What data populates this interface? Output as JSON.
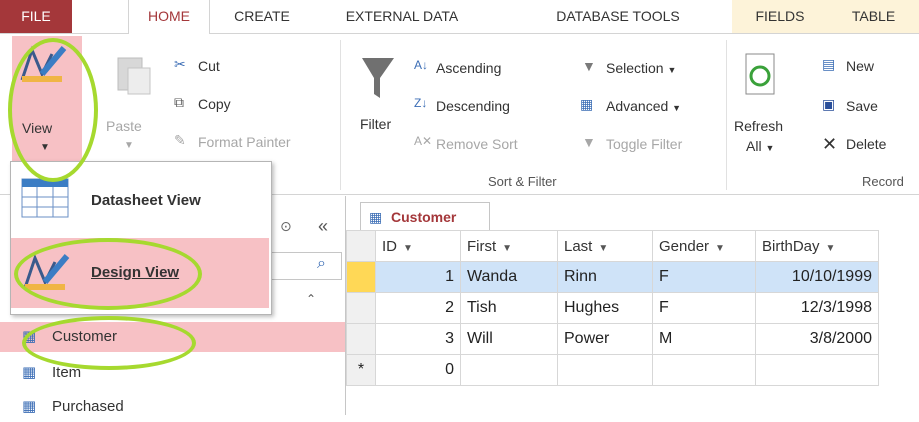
{
  "tabs": [
    "FILE",
    "HOME",
    "CREATE",
    "EXTERNAL DATA",
    "DATABASE TOOLS",
    "FIELDS",
    "TABLE"
  ],
  "ribbon": {
    "view_label": "View",
    "paste_label": "Paste",
    "cut_label": "Cut",
    "copy_label": "Copy",
    "format_painter_label": "Format Painter",
    "filter_label": "Filter",
    "ascending_label": "Ascending",
    "descending_label": "Descending",
    "remove_sort_label": "Remove Sort",
    "selection_label": "Selection",
    "advanced_label": "Advanced",
    "toggle_filter_label": "Toggle Filter",
    "sort_filter_group_label": "Sort & Filter",
    "refresh_label": "Refresh",
    "refresh_all_label": "All",
    "new_label": "New",
    "save_label": "Save",
    "delete_label": "Delete",
    "records_group_label": "Record"
  },
  "view_menu": {
    "datasheet_view": "Datasheet View",
    "design_view": "Design View"
  },
  "nav": {
    "collapse_glyph": "«",
    "items": [
      "Customer",
      "Item",
      "Purchased"
    ]
  },
  "datasheet": {
    "tab_label": "Customer",
    "columns": [
      "ID",
      "First",
      "Last",
      "Gender",
      "BirthDay"
    ],
    "rows": [
      {
        "id": "1",
        "first": "Wanda",
        "last": "Rinn",
        "gender": "F",
        "birthday": "10/10/1999"
      },
      {
        "id": "2",
        "first": "Tish",
        "last": "Hughes",
        "gender": "F",
        "birthday": "12/3/1998"
      },
      {
        "id": "3",
        "first": "Will",
        "last": "Power",
        "gender": "M",
        "birthday": "3/8/2000"
      }
    ],
    "new_row_marker": "*",
    "new_row_id": "0"
  },
  "colors": {
    "accent": "#a4373a",
    "highlight_ring": "#a6d92f",
    "selection_pink": "#f7c1c5"
  }
}
